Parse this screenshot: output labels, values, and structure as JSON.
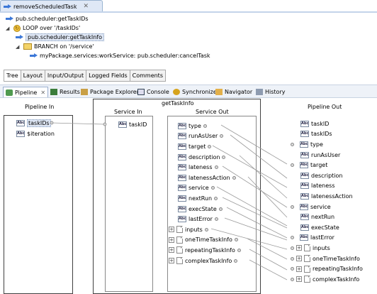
{
  "editor_tab": {
    "title": "removeScheduledTask",
    "close": "✕"
  },
  "flow": {
    "step1": "pub.scheduler:getTaskIDs",
    "step2": "LOOP over '/taskIDs'",
    "step3": "pub.scheduler:getTaskInfo",
    "step4": "BRANCH on '/service'",
    "step5": "myPackage.services:workService: pub.scheduler:cancelTask"
  },
  "editor_tabs": [
    "Tree",
    "Layout",
    "Input/Output",
    "Logged Fields",
    "Comments"
  ],
  "view_tabs": {
    "pipeline": "Pipeline",
    "close": "✕",
    "results": "Results",
    "package_explorer": "Package Explorer",
    "console": "Console",
    "synchronize": "Synchronize",
    "navigator": "Navigator",
    "history": "History"
  },
  "pipeline": {
    "pipeline_in_header": "Pipeline In",
    "pipeline_in": [
      "taskIDs",
      "$iteration"
    ],
    "service_title": "getTaskInfo",
    "service_in_header": "Service In",
    "service_in": [
      "taskID"
    ],
    "service_out_header": "Service Out",
    "service_out": [
      "type",
      "runAsUser",
      "target",
      "description",
      "lateness",
      "latenessAction",
      "service",
      "nextRun",
      "execState",
      "lastError",
      "inputs",
      "oneTimeTaskInfo",
      "repeatingTaskInfo",
      "complexTaskInfo"
    ],
    "pipeline_out_header": "Pipeline Out",
    "pipeline_out": [
      "taskID",
      "taskIDs",
      "type",
      "runAsUser",
      "target",
      "description",
      "lateness",
      "latenessAction",
      "service",
      "nextRun",
      "execState",
      "lastError",
      "inputs",
      "oneTimeTaskInfo",
      "repeatingTaskInfo",
      "complexTaskInfo"
    ]
  },
  "colors": {
    "accent": "#3c78d8",
    "tab_bg": "#dfe8f6",
    "selection": "#dfe7f5"
  }
}
